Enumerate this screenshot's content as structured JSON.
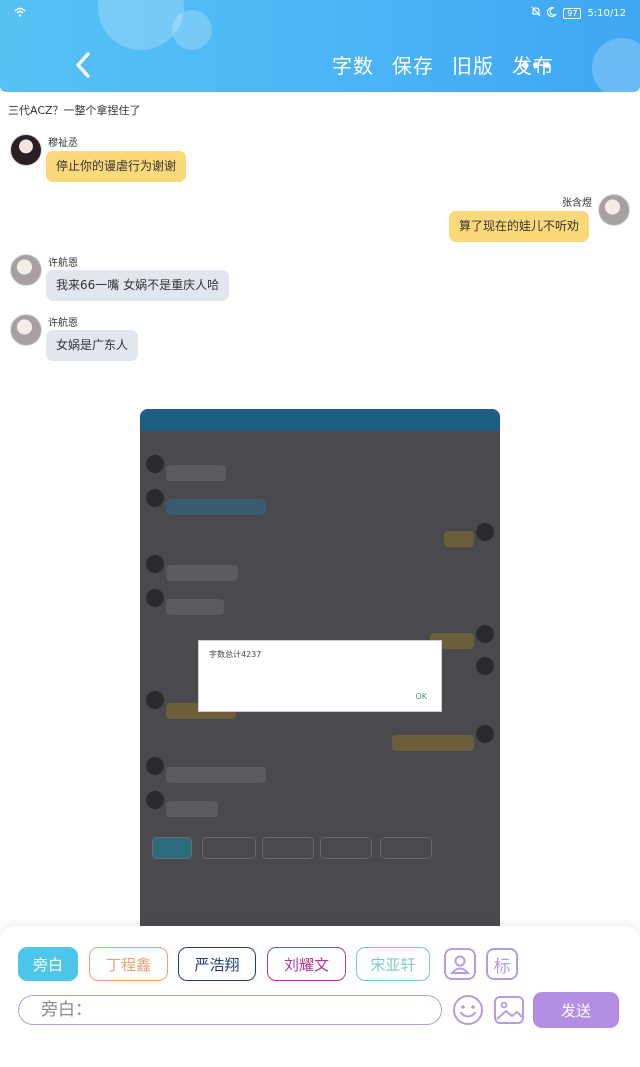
{
  "status_bar": {
    "time": "5:10/12",
    "battery": "97"
  },
  "header": {
    "actions": [
      "字数",
      "保存",
      "旧版",
      "发布"
    ],
    "more_label": "•••"
  },
  "topic": "三代ACZ？一整个拿捏住了",
  "messages": [
    {
      "name": "穆祉丞",
      "text": "停止你的谩虐行为谢谢",
      "side": "left",
      "color": "yellow"
    },
    {
      "name": "张含煜",
      "text": "算了现在的娃儿不听劝",
      "side": "right",
      "color": "yellow"
    },
    {
      "name": "许航恩",
      "text": "我来66一嘴 女娲不是重庆人哈",
      "side": "left",
      "color": "grey"
    },
    {
      "name": "许航恩",
      "text": "女娲是广东人",
      "side": "left",
      "color": "grey"
    }
  ],
  "embedded_dialog": {
    "text": "字数总计4237",
    "ok": "OK"
  },
  "chips": [
    {
      "label": "旁白",
      "color": "#4ec6ea",
      "filled": true
    },
    {
      "label": "丁程鑫",
      "color": "#f0a070",
      "filled": false
    },
    {
      "label": "严浩翔",
      "color": "#1f3f7a",
      "filled": false
    },
    {
      "label": "刘耀文",
      "color": "#b03a8a",
      "filled": false
    },
    {
      "label": "宋亚轩",
      "color": "#7fc8c8",
      "filled": false
    }
  ],
  "icons": {
    "person": "person-icon",
    "tag": "标",
    "emoji": "emoji-icon",
    "image": "image-icon"
  },
  "input": {
    "placeholder": "旁白："
  },
  "send_label": "发送"
}
